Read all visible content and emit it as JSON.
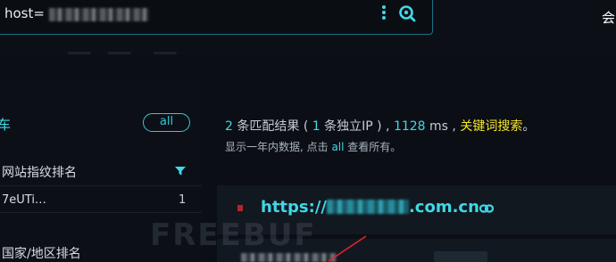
{
  "search": {
    "value": "host="
  },
  "header": {
    "lang_char": "会"
  },
  "icons": {
    "menu": "kebab-menu-icon",
    "search": "search-icon",
    "filter": "filter-icon",
    "link": "link-icon"
  },
  "colors": {
    "accent": "#3fd8e6",
    "highlight": "#f5e52a",
    "background": "#0b0f15",
    "card": "#121820",
    "mark": "#b3252b"
  },
  "sidebar": {
    "tab_partial": "车",
    "all_label": "all",
    "fingerprint_title": "网站指纹排名",
    "fingerprint_items": [
      {
        "name": "7eUTi…",
        "count": "1"
      }
    ],
    "region_title": "国家/地区排名"
  },
  "summary": {
    "count": "2",
    "text1": " 条匹配结果 ( ",
    "unique": "1",
    "text2": " 条独立IP ) ,  ",
    "time": "1128",
    "text3": " ms ,  ",
    "keyword_search": "关键词搜索",
    "text4": "。",
    "sub_prefix": "显示一年内数据, 点击 ",
    "sub_all": "all",
    "sub_suffix": " 查看所有。"
  },
  "result": {
    "url_prefix": "https://",
    "url_suffix": ".com.cn"
  },
  "watermark": "FREEBUF"
}
